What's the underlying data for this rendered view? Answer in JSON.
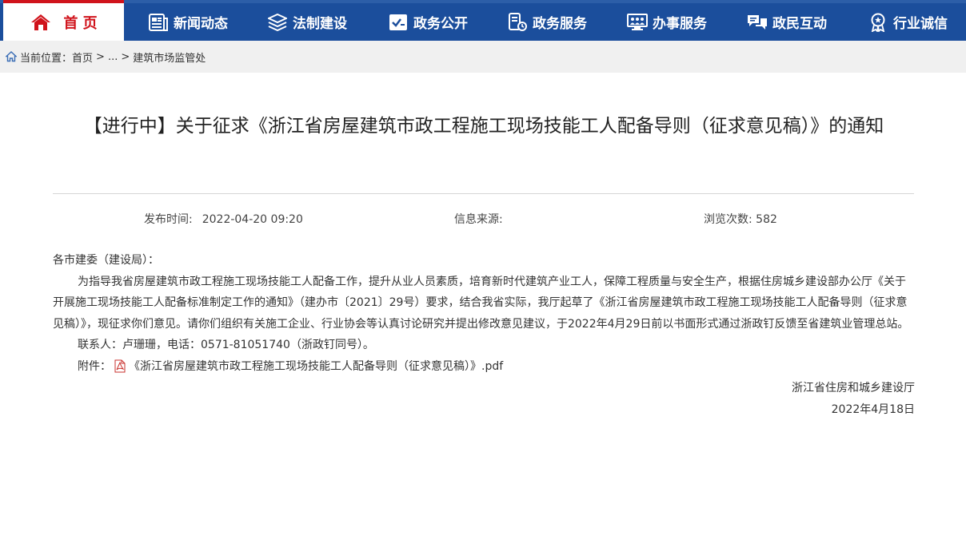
{
  "nav": {
    "home": "首 页",
    "items": [
      {
        "label": "新闻动态",
        "icon": "news-icon"
      },
      {
        "label": "法制建设",
        "icon": "layers-icon"
      },
      {
        "label": "政务公开",
        "icon": "open-affairs-icon"
      },
      {
        "label": "政务服务",
        "icon": "service-icon"
      },
      {
        "label": "办事服务",
        "icon": "monitor-people-icon"
      },
      {
        "label": "政民互动",
        "icon": "chat-icon"
      },
      {
        "label": "行业诚信",
        "icon": "badge-icon"
      }
    ],
    "colors": {
      "bar": "#1b4e9c",
      "home_accent": "#d0131b"
    }
  },
  "breadcrumb": {
    "prefix": "当前位置：",
    "home": "首页",
    "sep": ">",
    "ellipsis": "...",
    "current": "建筑市场监管处"
  },
  "article": {
    "title": "【进行中】关于征求《浙江省房屋建筑市政工程施工现场技能工人配备导则（征求意见稿）》的通知",
    "publish_label": "发布时间:",
    "publish_value": "2022-04-20 09:20",
    "source_label": "信息来源:",
    "source_value": "",
    "views_label": "浏览次数:",
    "views_value": "582",
    "salutation": "各市建委（建设局）：",
    "paragraph": "为指导我省房屋建筑市政工程施工现场技能工人配备工作，提升从业人员素质，培育新时代建筑产业工人，保障工程质量与安全生产，根据住房城乡建设部办公厅《关于开展施工现场技能工人配备标准制定工作的通知》（建办市〔2021〕29号）要求，结合我省实际，我厅起草了《浙江省房屋建筑市政工程施工现场技能工人配备导则（征求意见稿）》，现征求你们意见。请你们组织有关施工企业、行业协会等认真讨论研究并提出修改意见建议，于2022年4月29日前以书面形式通过浙政钉反馈至省建筑业管理总站。",
    "contact": "联系人：卢珊珊，电话：0571-81051740（浙政钉同号）。",
    "attachment_label": "附件：",
    "attachment_name": "《浙江省房屋建筑市政工程施工现场技能工人配备导则（征求意见稿）》.pdf",
    "signer": "浙江省住房和城乡建设厅",
    "date": "2022年4月18日"
  }
}
